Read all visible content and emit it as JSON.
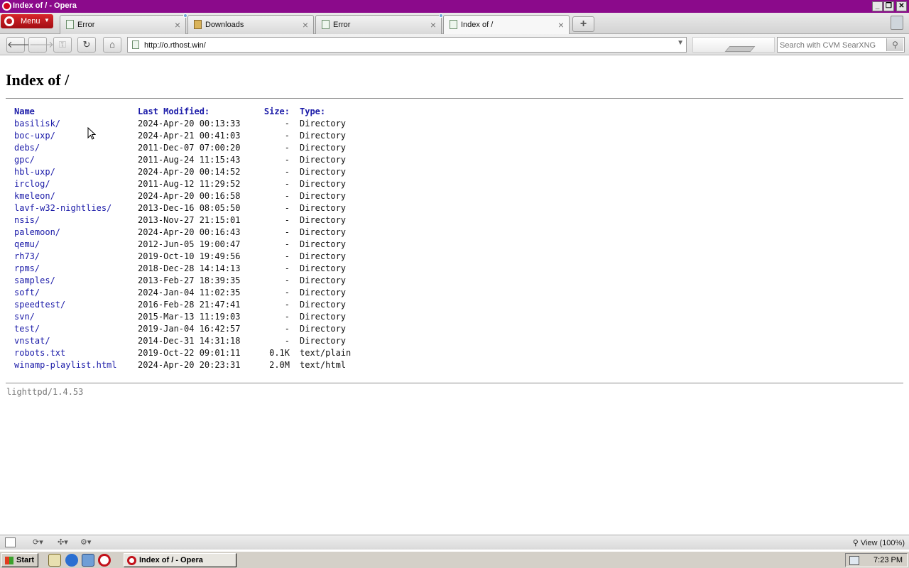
{
  "window": {
    "title": "Index of / - Opera"
  },
  "tabs": [
    {
      "label": "Error"
    },
    {
      "label": "Downloads"
    },
    {
      "label": "Error"
    },
    {
      "label": "Index of /"
    }
  ],
  "menu": {
    "label": "Menu"
  },
  "toolbar": {
    "url": "http://o.rthost.win/",
    "search_placeholder": "Search with CVM SearXNG"
  },
  "page": {
    "heading": "Index of /",
    "columns": {
      "name": "Name",
      "modified": "Last Modified:",
      "size": "Size:",
      "type": "Type:"
    },
    "entries": [
      {
        "name": "basilisk/",
        "modified": "2024-Apr-20 00:13:33",
        "size": "-",
        "type": "Directory"
      },
      {
        "name": "boc-uxp/",
        "modified": "2024-Apr-21 00:41:03",
        "size": "-",
        "type": "Directory"
      },
      {
        "name": "debs/",
        "modified": "2011-Dec-07 07:00:20",
        "size": "-",
        "type": "Directory"
      },
      {
        "name": "gpc/",
        "modified": "2011-Aug-24 11:15:43",
        "size": "-",
        "type": "Directory"
      },
      {
        "name": "hbl-uxp/",
        "modified": "2024-Apr-20 00:14:52",
        "size": "-",
        "type": "Directory"
      },
      {
        "name": "irclog/",
        "modified": "2011-Aug-12 11:29:52",
        "size": "-",
        "type": "Directory"
      },
      {
        "name": "kmeleon/",
        "modified": "2024-Apr-20 00:16:58",
        "size": "-",
        "type": "Directory"
      },
      {
        "name": "lavf-w32-nightlies/",
        "modified": "2013-Dec-16 08:05:50",
        "size": "-",
        "type": "Directory"
      },
      {
        "name": "nsis/",
        "modified": "2013-Nov-27 21:15:01",
        "size": "-",
        "type": "Directory"
      },
      {
        "name": "palemoon/",
        "modified": "2024-Apr-20 00:16:43",
        "size": "-",
        "type": "Directory"
      },
      {
        "name": "qemu/",
        "modified": "2012-Jun-05 19:00:47",
        "size": "-",
        "type": "Directory"
      },
      {
        "name": "rh73/",
        "modified": "2019-Oct-10 19:49:56",
        "size": "-",
        "type": "Directory"
      },
      {
        "name": "rpms/",
        "modified": "2018-Dec-28 14:14:13",
        "size": "-",
        "type": "Directory"
      },
      {
        "name": "samples/",
        "modified": "2013-Feb-27 18:39:35",
        "size": "-",
        "type": "Directory"
      },
      {
        "name": "soft/",
        "modified": "2024-Jan-04 11:02:35",
        "size": "-",
        "type": "Directory"
      },
      {
        "name": "speedtest/",
        "modified": "2016-Feb-28 21:47:41",
        "size": "-",
        "type": "Directory"
      },
      {
        "name": "svn/",
        "modified": "2015-Mar-13 11:19:03",
        "size": "-",
        "type": "Directory"
      },
      {
        "name": "test/",
        "modified": "2019-Jan-04 16:42:57",
        "size": "-",
        "type": "Directory"
      },
      {
        "name": "vnstat/",
        "modified": "2014-Dec-31 14:31:18",
        "size": "-",
        "type": "Directory"
      },
      {
        "name": "robots.txt",
        "modified": "2019-Oct-22 09:01:11",
        "size": "0.1K",
        "type": "text/plain"
      },
      {
        "name": "winamp-playlist.html",
        "modified": "2024-Apr-20 20:23:31",
        "size": "2.0M",
        "type": "text/html"
      }
    ],
    "server": "lighttpd/1.4.53"
  },
  "statusbar": {
    "zoom": "View (100%)"
  },
  "taskbar": {
    "start_label": "Start",
    "task_label": "Index of / - Opera",
    "clock": "7:23 PM"
  },
  "colors": {
    "titlebar": "#8b0a8b",
    "link": "#1a1aa8"
  }
}
